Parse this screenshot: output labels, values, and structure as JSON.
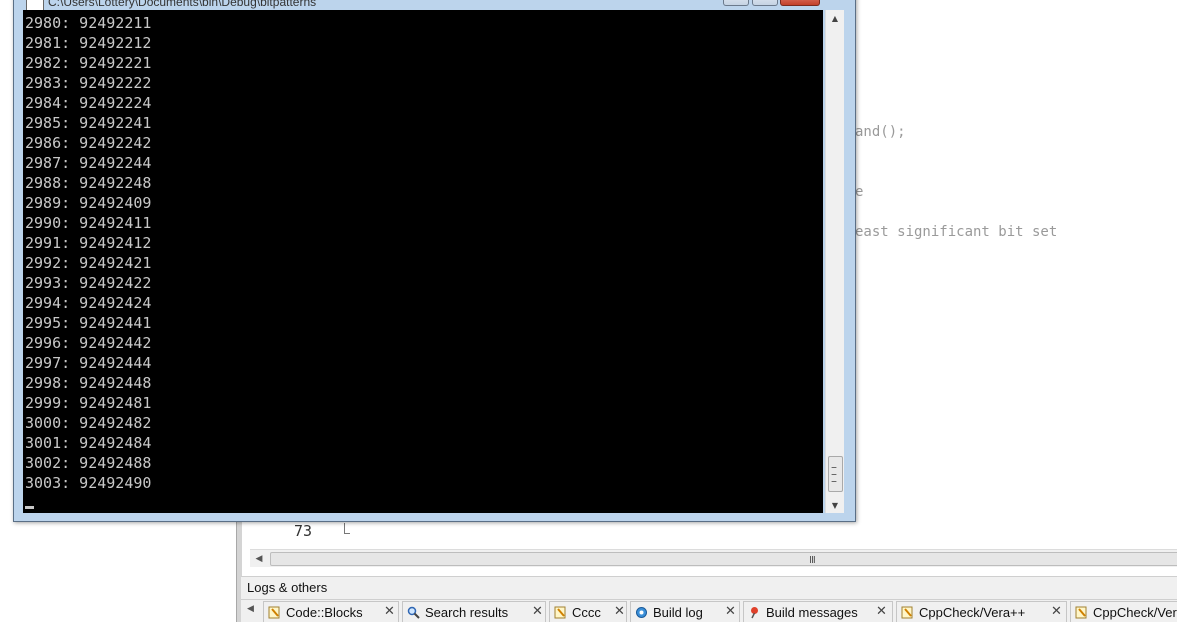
{
  "console": {
    "title": "C:\\Users\\Lottery\\Documents\\bin\\Debug\\bitpatterns",
    "lines": [
      "2980: 92492211",
      "2981: 92492212",
      "2982: 92492221",
      "2983: 92492222",
      "2984: 92492224",
      "2985: 92492241",
      "2986: 92492242",
      "2987: 92492244",
      "2988: 92492248",
      "2989: 92492409",
      "2990: 92492411",
      "2991: 92492412",
      "2992: 92492421",
      "2993: 92492422",
      "2994: 92492424",
      "2995: 92492441",
      "2996: 92492442",
      "2997: 92492444",
      "2998: 92492448",
      "2999: 92492481",
      "3000: 92492482",
      "3001: 92492484",
      "3002: 92492488",
      "3003: 92492490"
    ],
    "close_glyph": "✕"
  },
  "editor": {
    "visible_code_fragments": [
      "and();",
      "e",
      "east significant bit set"
    ],
    "gutter_line_number": "73",
    "hscroll_grip": "III"
  },
  "logs_panel": {
    "title": "Logs & others",
    "tabs": [
      {
        "label": "Code::Blocks",
        "icon": "notepad-icon"
      },
      {
        "label": "Search results",
        "icon": "magnifier-icon"
      },
      {
        "label": "Cccc",
        "icon": "notepad-icon"
      },
      {
        "label": "Build log",
        "icon": "gear-icon"
      },
      {
        "label": "Build messages",
        "icon": "pin-icon"
      },
      {
        "label": "CppCheck/Vera++",
        "icon": "notepad-icon"
      },
      {
        "label": "CppCheck/Vera",
        "icon": "notepad-icon"
      }
    ],
    "close_glyph": "✕"
  }
}
